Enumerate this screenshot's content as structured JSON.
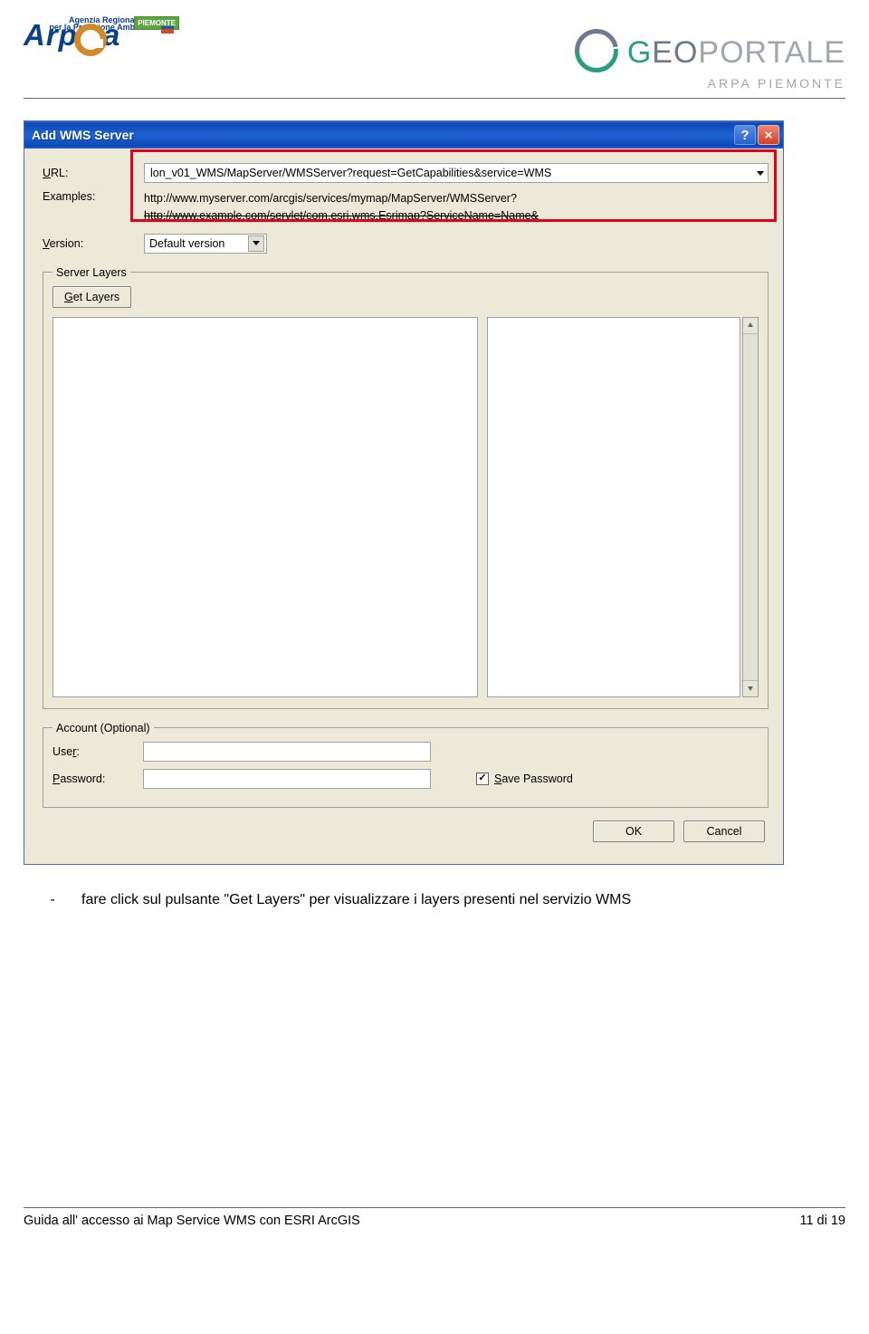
{
  "header": {
    "arpa": {
      "piemonte_tag": "PIEMONTE",
      "sub1": "Agenzia Regionale",
      "sub2": "per la Protezione Ambientale"
    },
    "geo": {
      "g": "G",
      "eo": "EO",
      "portale": "PORTALE",
      "sub": "ARPA PIEMONTE"
    }
  },
  "dialog": {
    "title": "Add WMS Server",
    "labels": {
      "url": "URL:",
      "examples": "Examples:",
      "version": "Version:",
      "server_layers": "Server Layers",
      "get_layers": "Get Layers",
      "account": "Account (Optional)",
      "user": "User:",
      "password": "Password:",
      "save_password": "Save Password",
      "ok": "OK",
      "cancel": "Cancel"
    },
    "url_value": "lon_v01_WMS/MapServer/WMSServer?request=GetCapabilities&service=WMS",
    "example1": "http://www.myserver.com/arcgis/services/mymap/MapServer/WMSServer?",
    "example2": "http://www.example.com/servlet/com.esri.wms.Esrimap?ServiceName=Name&",
    "version_value": "Default version",
    "user_value": "",
    "password_value": "",
    "save_password_checked": "✓",
    "help_icon": "?",
    "close_icon": "×"
  },
  "instruction": {
    "dash": "-",
    "text": "fare click sul pulsante \"Get Layers\" per visualizzare i layers presenti nel servizio WMS"
  },
  "footer": {
    "left": "Guida all' accesso ai Map Service WMS con ESRI ArcGIS",
    "right": "11 di 19"
  }
}
